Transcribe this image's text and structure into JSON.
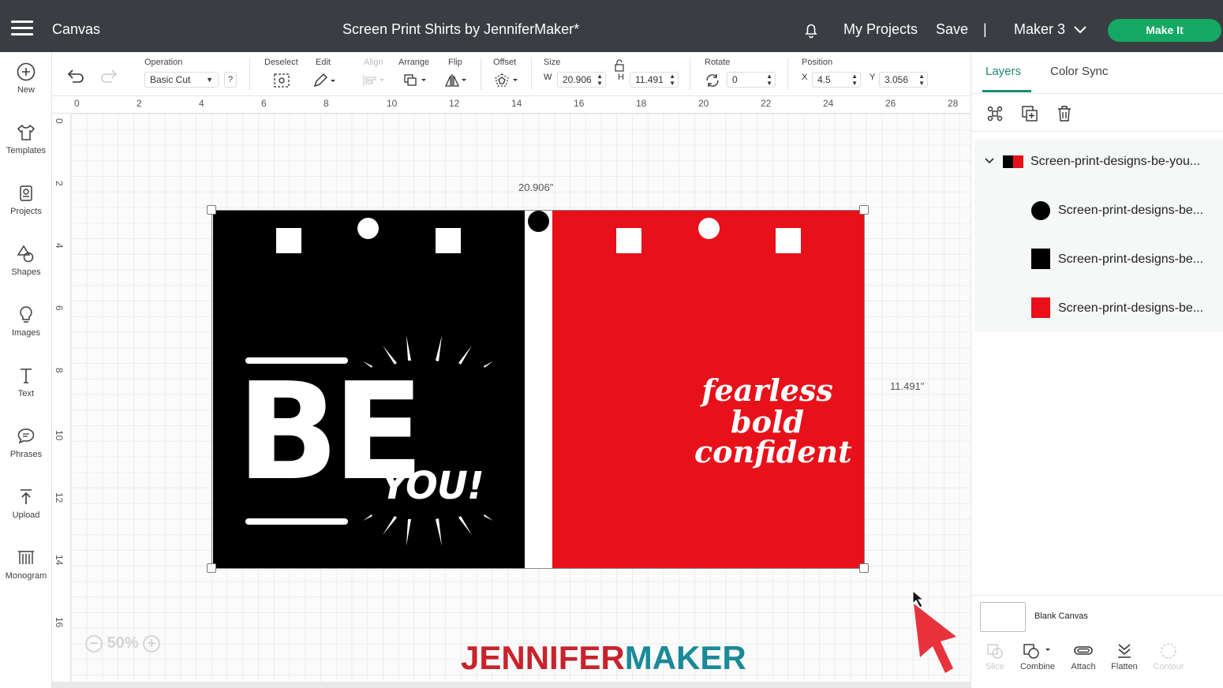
{
  "topbar": {
    "app_title": "Canvas",
    "doc_title": "Screen Print Shirts by JenniferMaker*",
    "my_projects": "My Projects",
    "save": "Save",
    "separator": "|",
    "machine": "Maker 3",
    "make_it": "Make It",
    "make_it_color": "#14a865"
  },
  "sidebar": {
    "items": [
      {
        "label": "New",
        "icon": "plus-circle-icon"
      },
      {
        "label": "Templates",
        "icon": "shirt-icon"
      },
      {
        "label": "Projects",
        "icon": "projects-icon"
      },
      {
        "label": "Shapes",
        "icon": "shapes-icon"
      },
      {
        "label": "Images",
        "icon": "lightbulb-icon"
      },
      {
        "label": "Text",
        "icon": "text-icon"
      },
      {
        "label": "Phrases",
        "icon": "speech-bubble-icon"
      },
      {
        "label": "Upload",
        "icon": "upload-icon"
      },
      {
        "label": "Monogram",
        "icon": "monogram-icon"
      }
    ]
  },
  "toolbar": {
    "operation_label": "Operation",
    "operation_value": "Basic Cut",
    "help": "?",
    "deselect_label": "Deselect",
    "edit_label": "Edit",
    "align_label": "Align",
    "arrange_label": "Arrange",
    "flip_label": "Flip",
    "offset_label": "Offset",
    "size_label": "Size",
    "w_label": "W",
    "w_value": "20.906",
    "h_label": "H",
    "h_value": "11.491",
    "rotate_label": "Rotate",
    "rotate_value": "0",
    "position_label": "Position",
    "x_label": "X",
    "x_value": "4.5",
    "y_label": "Y",
    "y_value": "3.056"
  },
  "ruler": {
    "top": [
      "0",
      "2",
      "4",
      "6",
      "8",
      "10",
      "12",
      "14",
      "16",
      "18",
      "20",
      "22",
      "24",
      "26",
      "28"
    ],
    "left": [
      "0",
      "2",
      "4",
      "6",
      "8",
      "10",
      "12",
      "14",
      "16"
    ]
  },
  "canvas": {
    "width_dim": "20.906\"",
    "height_dim": "11.491\"",
    "be_text": "BE",
    "you_text": "YOU!",
    "script_lines": [
      "fearless",
      "bold",
      "confident"
    ],
    "zoom": "50%",
    "brand_part1": "JENNIFER",
    "brand_part2": "MAKER",
    "panel_colors": {
      "left": "#000000",
      "middle": "#ffffff",
      "right": "#e81019"
    }
  },
  "layers_panel": {
    "tab_layers": "Layers",
    "tab_color_sync": "Color Sync",
    "group_name": "Screen-print-designs-be-you...",
    "children": [
      "Screen-print-designs-be...",
      "Screen-print-designs-be...",
      "Screen-print-designs-be..."
    ],
    "blank_canvas": "Blank Canvas",
    "bottom_tools": {
      "slice": "Slice",
      "combine": "Combine",
      "attach": "Attach",
      "flatten": "Flatten",
      "contour": "Contour"
    }
  }
}
